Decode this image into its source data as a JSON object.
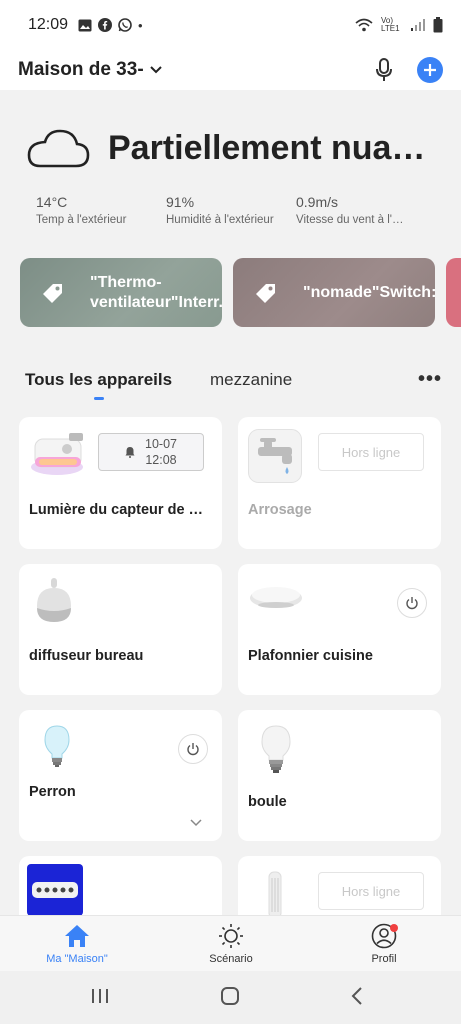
{
  "status_bar": {
    "time": "12:09",
    "dot": "•",
    "network": "Vo) LTE1"
  },
  "header": {
    "home_title": "Maison de 33-"
  },
  "weather": {
    "condition": "Partiellement nuageux",
    "stats": [
      {
        "value": "14°C",
        "label": "Temp à l'extérieur"
      },
      {
        "value": "91%",
        "label": "Humidité à l'extérieur"
      },
      {
        "value": "0.9m/s",
        "label": "Vitesse du vent à l'extérieur"
      }
    ]
  },
  "scenes": [
    {
      "label": "\"Thermo-ventilateur\"Interr..."
    },
    {
      "label": "\"nomade\"Switch:ON..."
    }
  ],
  "tabs": {
    "active": "Tous les appareils",
    "other": "mezzanine",
    "more": "•••"
  },
  "devices": [
    {
      "name": "Lumière du capteur de mouvement",
      "timer_date": "10-07",
      "timer_time": "12:08"
    },
    {
      "name": "Arrosage",
      "status": "Hors ligne"
    },
    {
      "name": "diffuseur bureau"
    },
    {
      "name": "Plafonnier cuisine"
    },
    {
      "name": "Perron"
    },
    {
      "name": "boule"
    },
    {
      "name": ""
    },
    {
      "name": "",
      "status": "Hors ligne"
    }
  ],
  "bottom_nav": [
    {
      "label": "Ma \"Maison\""
    },
    {
      "label": "Scénario"
    },
    {
      "label": "Profil"
    }
  ],
  "colors": {
    "accent": "#3a82f6",
    "badge_red": "#f04040"
  }
}
